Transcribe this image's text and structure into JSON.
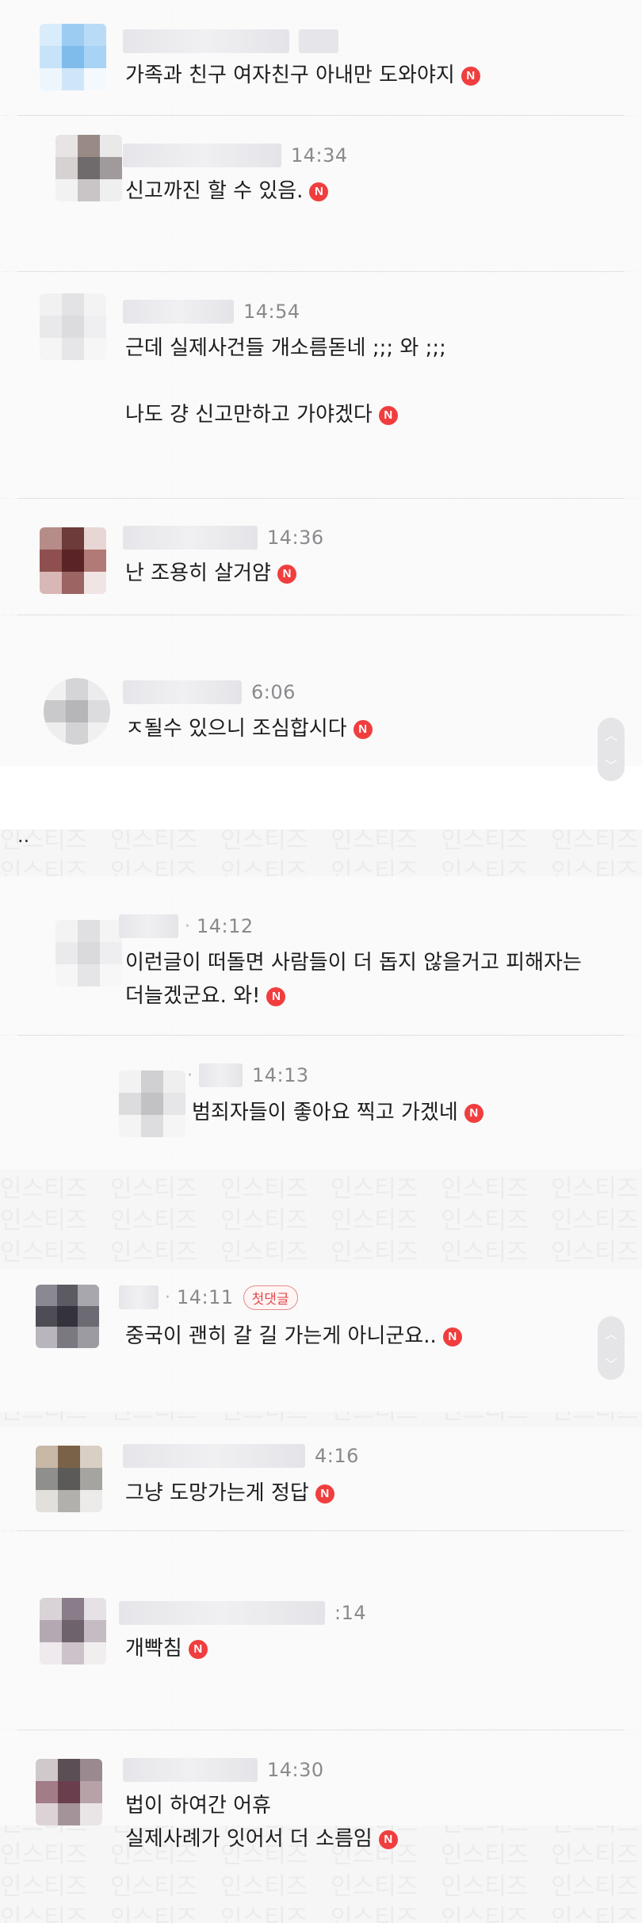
{
  "watermark": "인스티즈",
  "ellipsis_mark": "..",
  "new_badge": "N",
  "comments": [
    {
      "time": "",
      "lines": [
        "가족과 친구 여자친구 아내만 도와야지"
      ],
      "badge": "",
      "first": ""
    },
    {
      "time": "14:34",
      "lines": [
        "신고까진 할 수 있음."
      ],
      "first": ""
    },
    {
      "time": "14:54",
      "lines": [
        "근데 실제사건들 개소름돋네 ;;; 와 ;;;",
        "",
        "나도 걍 신고만하고 가야겠다"
      ],
      "first": ""
    },
    {
      "time": "14:36",
      "lines": [
        "난 조용히 살거얌"
      ],
      "first": ""
    },
    {
      "time": "6:06",
      "lines": [
        "ㅈ될수 있으니 조심합시다"
      ],
      "first": ""
    },
    {
      "time": "14:12",
      "lines": [
        "이런글이 떠돌면 사람들이 더 돕지 않을거고 피해자는",
        "더늘겠군요. 와!"
      ],
      "first": ""
    },
    {
      "time": "14:13",
      "lines": [
        "범죄자들이 좋아요 찍고 가겠네"
      ],
      "first": ""
    },
    {
      "time": "14:11",
      "lines": [
        "중국이 괜히 갈 길 가는게 아니군요.."
      ],
      "first": "첫댓글"
    },
    {
      "time": "4:16",
      "lines": [
        "그냥 도망가는게 정답"
      ],
      "first": ""
    },
    {
      "time": ":14",
      "lines": [
        "개빡침"
      ],
      "first": ""
    },
    {
      "time": "14:30",
      "lines": [
        "법이 하여간 어휴",
        "실제사례가 잇어서 더 소름임"
      ],
      "first": ""
    }
  ],
  "scroll_icons": {
    "up": "chevron-up-icon",
    "down": "chevron-down-icon"
  }
}
